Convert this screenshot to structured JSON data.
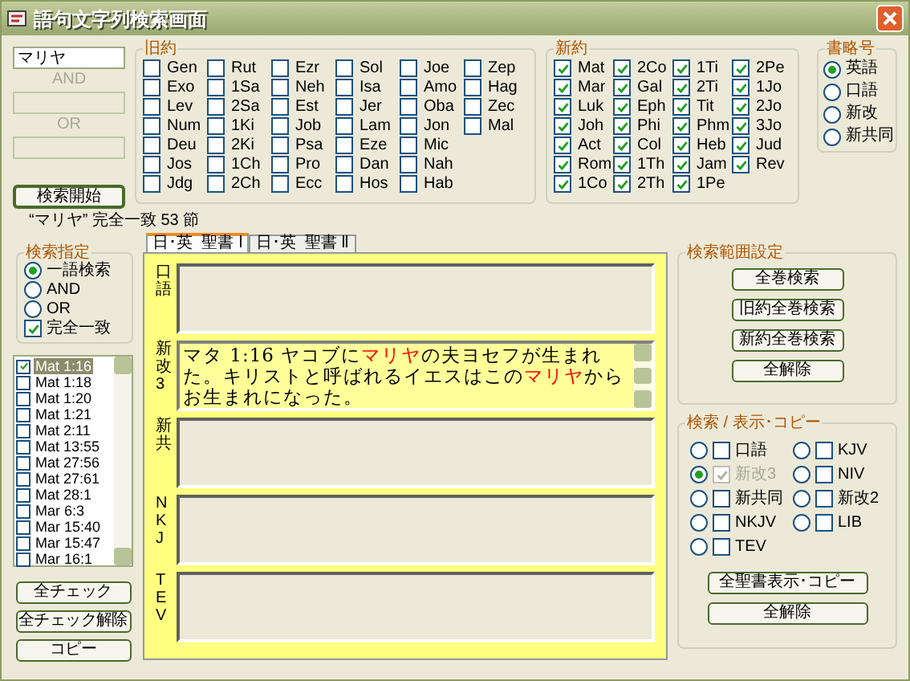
{
  "window": {
    "title": "語句文字列検索画面"
  },
  "query_fields": [
    {
      "value": "マリヤ",
      "disabled": false
    },
    {
      "label": "AND",
      "disabled": true
    },
    {
      "label": "OR",
      "disabled": true
    }
  ],
  "search_button": "検索開始",
  "old_testament": {
    "title": "旧約",
    "books": [
      {
        "label": "Gen",
        "checked": false
      },
      {
        "label": "Exo",
        "checked": false
      },
      {
        "label": "Lev",
        "checked": false
      },
      {
        "label": "Num",
        "checked": false
      },
      {
        "label": "Deu",
        "checked": false
      },
      {
        "label": "Jos",
        "checked": false
      },
      {
        "label": "Jdg",
        "checked": false
      },
      {
        "label": "Rut",
        "checked": false
      },
      {
        "label": "1Sa",
        "checked": false
      },
      {
        "label": "2Sa",
        "checked": false
      },
      {
        "label": "1Ki",
        "checked": false
      },
      {
        "label": "2Ki",
        "checked": false
      },
      {
        "label": "1Ch",
        "checked": false
      },
      {
        "label": "2Ch",
        "checked": false
      },
      {
        "label": "Ezr",
        "checked": false
      },
      {
        "label": "Neh",
        "checked": false
      },
      {
        "label": "Est",
        "checked": false
      },
      {
        "label": "Job",
        "checked": false
      },
      {
        "label": "Psa",
        "checked": false
      },
      {
        "label": "Pro",
        "checked": false
      },
      {
        "label": "Ecc",
        "checked": false
      },
      {
        "label": "Sol",
        "checked": false
      },
      {
        "label": "Isa",
        "checked": false
      },
      {
        "label": "Jer",
        "checked": false
      },
      {
        "label": "Lam",
        "checked": false
      },
      {
        "label": "Eze",
        "checked": false
      },
      {
        "label": "Dan",
        "checked": false
      },
      {
        "label": "Hos",
        "checked": false
      },
      {
        "label": "Joe",
        "checked": false
      },
      {
        "label": "Amo",
        "checked": false
      },
      {
        "label": "Oba",
        "checked": false
      },
      {
        "label": "Jon",
        "checked": false
      },
      {
        "label": "Mic",
        "checked": false
      },
      {
        "label": "Nah",
        "checked": false
      },
      {
        "label": "Hab",
        "checked": false
      },
      {
        "label": "Zep",
        "checked": false
      },
      {
        "label": "Hag",
        "checked": false
      },
      {
        "label": "Zec",
        "checked": false
      },
      {
        "label": "Mal",
        "checked": false
      }
    ]
  },
  "new_testament": {
    "title": "新約",
    "books": [
      {
        "label": "Mat",
        "checked": true
      },
      {
        "label": "Mar",
        "checked": true
      },
      {
        "label": "Luk",
        "checked": true
      },
      {
        "label": "Joh",
        "checked": true
      },
      {
        "label": "Act",
        "checked": true
      },
      {
        "label": "Rom",
        "checked": true
      },
      {
        "label": "1Co",
        "checked": true
      },
      {
        "label": "2Co",
        "checked": true
      },
      {
        "label": "Gal",
        "checked": true
      },
      {
        "label": "Eph",
        "checked": true
      },
      {
        "label": "Phi",
        "checked": true
      },
      {
        "label": "Col",
        "checked": true
      },
      {
        "label": "1Th",
        "checked": true
      },
      {
        "label": "2Th",
        "checked": true
      },
      {
        "label": "1Ti",
        "checked": true
      },
      {
        "label": "2Ti",
        "checked": true
      },
      {
        "label": "Tit",
        "checked": true
      },
      {
        "label": "Phm",
        "checked": true
      },
      {
        "label": "Heb",
        "checked": true
      },
      {
        "label": "Jam",
        "checked": true
      },
      {
        "label": "1Pe",
        "checked": true
      },
      {
        "label": "2Pe",
        "checked": true
      },
      {
        "label": "1Jo",
        "checked": true
      },
      {
        "label": "2Jo",
        "checked": true
      },
      {
        "label": "3Jo",
        "checked": true
      },
      {
        "label": "Jud",
        "checked": true
      },
      {
        "label": "Rev",
        "checked": true
      }
    ]
  },
  "abbreviation": {
    "title": "書略号",
    "options": [
      {
        "label": "英語",
        "selected": true
      },
      {
        "label": "口語",
        "selected": false
      },
      {
        "label": "新改",
        "selected": false
      },
      {
        "label": "新共同",
        "selected": false
      }
    ]
  },
  "status": "“マリヤ” 完全一致 53 節",
  "search_spec": {
    "title": "検索指定",
    "modes": [
      {
        "label": "一語検索",
        "selected": true
      },
      {
        "label": "AND",
        "selected": false
      },
      {
        "label": "OR",
        "selected": false
      }
    ],
    "exact_match": {
      "label": "完全一致",
      "checked": true
    }
  },
  "results": [
    {
      "label": "Mat 1:16",
      "checked": true,
      "selected": true
    },
    {
      "label": "Mat 1:18",
      "checked": false,
      "selected": false
    },
    {
      "label": "Mat 1:20",
      "checked": false,
      "selected": false
    },
    {
      "label": "Mat 1:21",
      "checked": false,
      "selected": false
    },
    {
      "label": "Mat 2:11",
      "checked": false,
      "selected": false
    },
    {
      "label": "Mat 13:55",
      "checked": false,
      "selected": false
    },
    {
      "label": "Mat 27:56",
      "checked": false,
      "selected": false
    },
    {
      "label": "Mat 27:61",
      "checked": false,
      "selected": false
    },
    {
      "label": "Mat 28:1",
      "checked": false,
      "selected": false
    },
    {
      "label": "Mar 6:3",
      "checked": false,
      "selected": false
    },
    {
      "label": "Mar 15:40",
      "checked": false,
      "selected": false
    },
    {
      "label": "Mar 15:47",
      "checked": false,
      "selected": false
    },
    {
      "label": "Mar 16:1",
      "checked": false,
      "selected": false
    }
  ],
  "list_buttons": [
    "全チェック",
    "全チェック解除",
    "コピー"
  ],
  "tabs": [
    {
      "label": "日･英  聖書 Ⅰ",
      "selected": true
    },
    {
      "label": "日･英  聖書 Ⅱ",
      "selected": false
    }
  ],
  "panes": [
    {
      "label": "口語"
    },
    {
      "label": "新改3",
      "segments": [
        {
          "text": "マタ 1:16 ヤコブに",
          "highlight": false
        },
        {
          "text": "マリヤ",
          "highlight": true
        },
        {
          "text": "の夫ヨセフが生まれた。キリストと呼ばれるイエスはこの",
          "highlight": false
        },
        {
          "text": "マリヤ",
          "highlight": true
        },
        {
          "text": "からお生まれになった。",
          "highlight": false
        }
      ]
    },
    {
      "label": "新共"
    },
    {
      "label": "NKJ"
    },
    {
      "label": "TEV"
    }
  ],
  "scope": {
    "title": "検索範囲設定",
    "buttons": [
      "全巻検索",
      "旧約全巻検索",
      "新約全巻検索",
      "全解除"
    ]
  },
  "display": {
    "title": "検索 / 表示･コピー",
    "versions": [
      {
        "label": "口語",
        "selected": false,
        "checked": false,
        "disabled": false
      },
      {
        "label": "新改3",
        "selected": true,
        "checked": true,
        "disabled": true
      },
      {
        "label": "新共同",
        "selected": false,
        "checked": false,
        "disabled": false
      },
      {
        "label": "NKJV",
        "selected": false,
        "checked": false,
        "disabled": false
      },
      {
        "label": "TEV",
        "selected": false,
        "checked": false,
        "disabled": false
      },
      {
        "label": "KJV",
        "selected": false,
        "checked": false,
        "disabled": false
      },
      {
        "label": "NIV",
        "selected": false,
        "checked": false,
        "disabled": false
      },
      {
        "label": "新改2",
        "selected": false,
        "checked": false,
        "disabled": false
      },
      {
        "label": "LIB",
        "selected": false,
        "checked": false,
        "disabled": false
      }
    ],
    "buttons": [
      "全聖書表示･コピー",
      "全解除"
    ]
  }
}
